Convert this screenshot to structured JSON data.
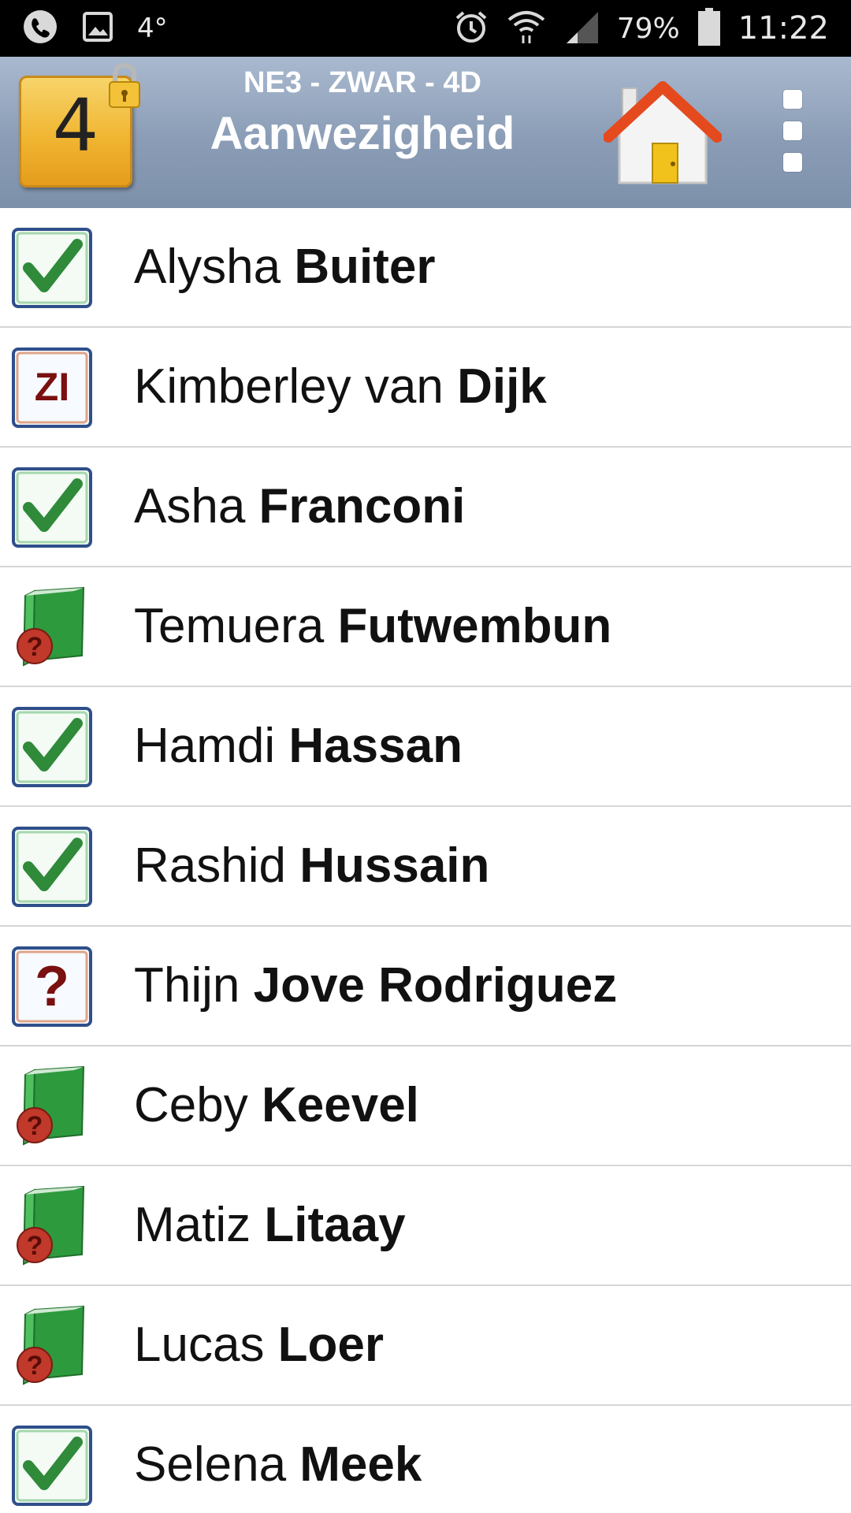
{
  "status_bar": {
    "temperature": "4°",
    "battery_percent": "79%",
    "time": "11:22",
    "icons": [
      "phone-icon",
      "image-icon",
      "alarm-icon",
      "wifi-icon",
      "signal-icon",
      "battery-icon"
    ]
  },
  "header": {
    "period_number": "4",
    "subtitle": "NE3 - ZWAR - 4D",
    "title": "Aanwezigheid",
    "icons": [
      "lock-icon",
      "home-icon",
      "overflow-menu-icon"
    ]
  },
  "students": [
    {
      "first": "Alysha",
      "last": "Buiter",
      "status": "present"
    },
    {
      "first": "Kimberley van",
      "last": "Dijk",
      "status": "zi",
      "status_label": "ZI"
    },
    {
      "first": "Asha",
      "last": "Franconi",
      "status": "present"
    },
    {
      "first": "Temuera",
      "last": "Futwembun",
      "status": "book-unknown"
    },
    {
      "first": "Hamdi",
      "last": "Hassan",
      "status": "present"
    },
    {
      "first": "Rashid",
      "last": "Hussain",
      "status": "present"
    },
    {
      "first": "Thijn",
      "last": "Jove Rodriguez",
      "status": "unknown",
      "status_label": "?"
    },
    {
      "first": "Ceby",
      "last": "Keevel",
      "status": "book-unknown"
    },
    {
      "first": "Matiz",
      "last": "Litaay",
      "status": "book-unknown"
    },
    {
      "first": "Lucas",
      "last": "Loer",
      "status": "book-unknown"
    },
    {
      "first": "Selena",
      "last": "Meek",
      "status": "present"
    }
  ],
  "colors": {
    "header_top": "#a9b9cf",
    "header_bottom": "#7d90aa",
    "check_green": "#2f8a3a",
    "zi_red": "#7a1010",
    "book_green": "#2e9a3e",
    "badge_gold": "#f0b632"
  }
}
